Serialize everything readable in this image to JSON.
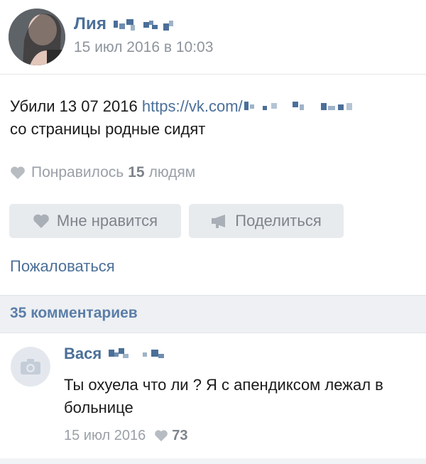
{
  "post": {
    "author_name": "Лия",
    "date": "15 июл 2016 в 10:03",
    "text_before_link": "Убили 13 07 2016 ",
    "link_text": "https://vk.com/",
    "text_after_link": "со страницы родные сидят",
    "likes_prefix": "Понравилось",
    "likes_count": "15",
    "likes_suffix": "людям"
  },
  "actions": {
    "like_label": "Мне нравится",
    "share_label": "Поделиться",
    "report_label": "Пожаловаться"
  },
  "comments_header": {
    "label": "35 комментариев"
  },
  "comment": {
    "author_name": "Вася",
    "text": "Ты охуела что ли ? Я с апендиксом лежал в больнице",
    "date": "15 июл 2016",
    "likes": "73"
  },
  "icons": {
    "heart": "heart-icon",
    "megaphone": "megaphone-icon",
    "camera": "camera-icon"
  },
  "colors": {
    "link": "#4b6f99",
    "muted": "#8e949c",
    "button_bg": "#e8ebee",
    "bar_bg": "#eef0f3"
  }
}
